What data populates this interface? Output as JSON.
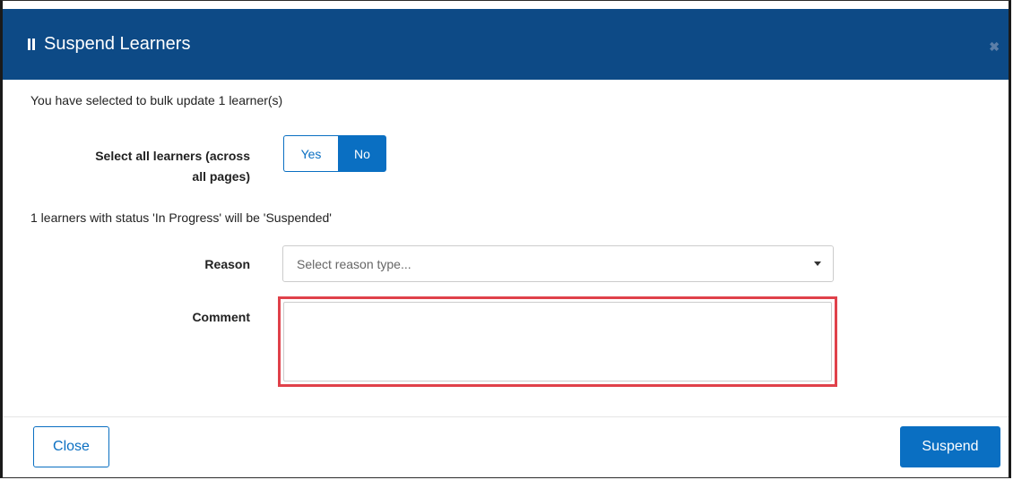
{
  "modal": {
    "title": "Suspend Learners",
    "title_icon": "pause-icon",
    "close_icon": "close-icon",
    "close_glyph": "✖"
  },
  "form": {
    "bulk_message": "You have selected to bulk update 1 learner(s)",
    "select_all_label_line1": "Select all learners (across",
    "select_all_label_line2": "all pages)",
    "toggle": {
      "yes_label": "Yes",
      "no_label": "No",
      "selected": "No"
    },
    "status_message": "1 learners with status 'In Progress' will be 'Suspended'",
    "reason_label": "Reason",
    "reason_placeholder": "Select reason type...",
    "comment_label": "Comment",
    "comment_value": ""
  },
  "footer": {
    "close_label": "Close",
    "suspend_label": "Suspend"
  },
  "colors": {
    "header": "#0d4a86",
    "primary": "#0a6fc2",
    "highlight_border": "#e0414a"
  }
}
